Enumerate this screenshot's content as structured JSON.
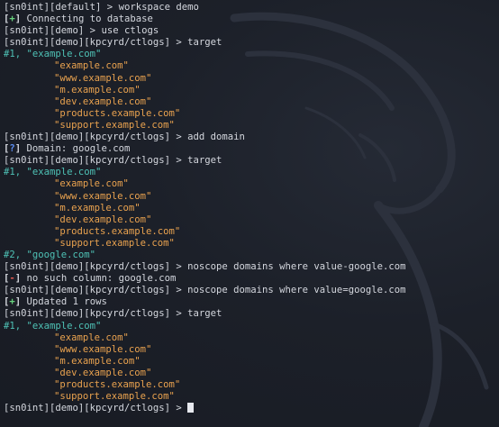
{
  "terminal": {
    "lines": [
      {
        "type": "prompt",
        "prompt": "[sn0int][default] > ",
        "command": "workspace demo"
      },
      {
        "type": "status",
        "open": "[",
        "marker": "+",
        "close": "]",
        "marker_color": "green",
        "text": " Connecting to database"
      },
      {
        "type": "prompt",
        "prompt": "[sn0int][demo] > ",
        "command": "use ctlogs"
      },
      {
        "type": "prompt",
        "prompt": "[sn0int][demo][kpcyrd/ctlogs] > ",
        "command": "target"
      },
      {
        "type": "header",
        "text": "#1, \"example.com\""
      },
      {
        "type": "item",
        "text": "\"example.com\""
      },
      {
        "type": "item",
        "text": "\"www.example.com\""
      },
      {
        "type": "item",
        "text": "\"m.example.com\""
      },
      {
        "type": "item",
        "text": "\"dev.example.com\""
      },
      {
        "type": "item",
        "text": "\"products.example.com\""
      },
      {
        "type": "item",
        "text": "\"support.example.com\""
      },
      {
        "type": "prompt",
        "prompt": "[sn0int][demo][kpcyrd/ctlogs] > ",
        "command": "add domain"
      },
      {
        "type": "status",
        "open": "[",
        "marker": "?",
        "close": "]",
        "marker_color": "blue",
        "text": " Domain: google.com"
      },
      {
        "type": "prompt",
        "prompt": "[sn0int][demo][kpcyrd/ctlogs] > ",
        "command": "target"
      },
      {
        "type": "header",
        "text": "#1, \"example.com\""
      },
      {
        "type": "item",
        "text": "\"example.com\""
      },
      {
        "type": "item",
        "text": "\"www.example.com\""
      },
      {
        "type": "item",
        "text": "\"m.example.com\""
      },
      {
        "type": "item",
        "text": "\"dev.example.com\""
      },
      {
        "type": "item",
        "text": "\"products.example.com\""
      },
      {
        "type": "item",
        "text": "\"support.example.com\""
      },
      {
        "type": "header",
        "text": "#2, \"google.com\""
      },
      {
        "type": "prompt",
        "prompt": "[sn0int][demo][kpcyrd/ctlogs] > ",
        "command": "noscope domains where value-google.com"
      },
      {
        "type": "status",
        "open": "[",
        "marker": "-",
        "close": "]",
        "marker_color": "red",
        "text": " no such column: google.com"
      },
      {
        "type": "prompt",
        "prompt": "[sn0int][demo][kpcyrd/ctlogs] > ",
        "command": "noscope domains where value=google.com"
      },
      {
        "type": "status",
        "open": "[",
        "marker": "+",
        "close": "]",
        "marker_color": "green",
        "text": " Updated 1 rows"
      },
      {
        "type": "prompt",
        "prompt": "[sn0int][demo][kpcyrd/ctlogs] > ",
        "command": "target"
      },
      {
        "type": "header",
        "text": "#1, \"example.com\""
      },
      {
        "type": "item",
        "text": "\"example.com\""
      },
      {
        "type": "item",
        "text": "\"www.example.com\""
      },
      {
        "type": "item",
        "text": "\"m.example.com\""
      },
      {
        "type": "item",
        "text": "\"dev.example.com\""
      },
      {
        "type": "item",
        "text": "\"products.example.com\""
      },
      {
        "type": "item",
        "text": "\"support.example.com\""
      },
      {
        "type": "prompt",
        "prompt": "[sn0int][demo][kpcyrd/ctlogs] > ",
        "command": "",
        "cursor": true
      }
    ]
  },
  "colors": {
    "background": "#1b1f28",
    "text": "#d4d7de",
    "teal": "#4ec1b5",
    "orange": "#e9a24f",
    "green": "#68d27e",
    "blue": "#5b8df0",
    "red": "#e0574f"
  },
  "icons": {
    "watermark": "kali-dragon-watermark-icon",
    "cursor": "block-cursor-icon"
  }
}
